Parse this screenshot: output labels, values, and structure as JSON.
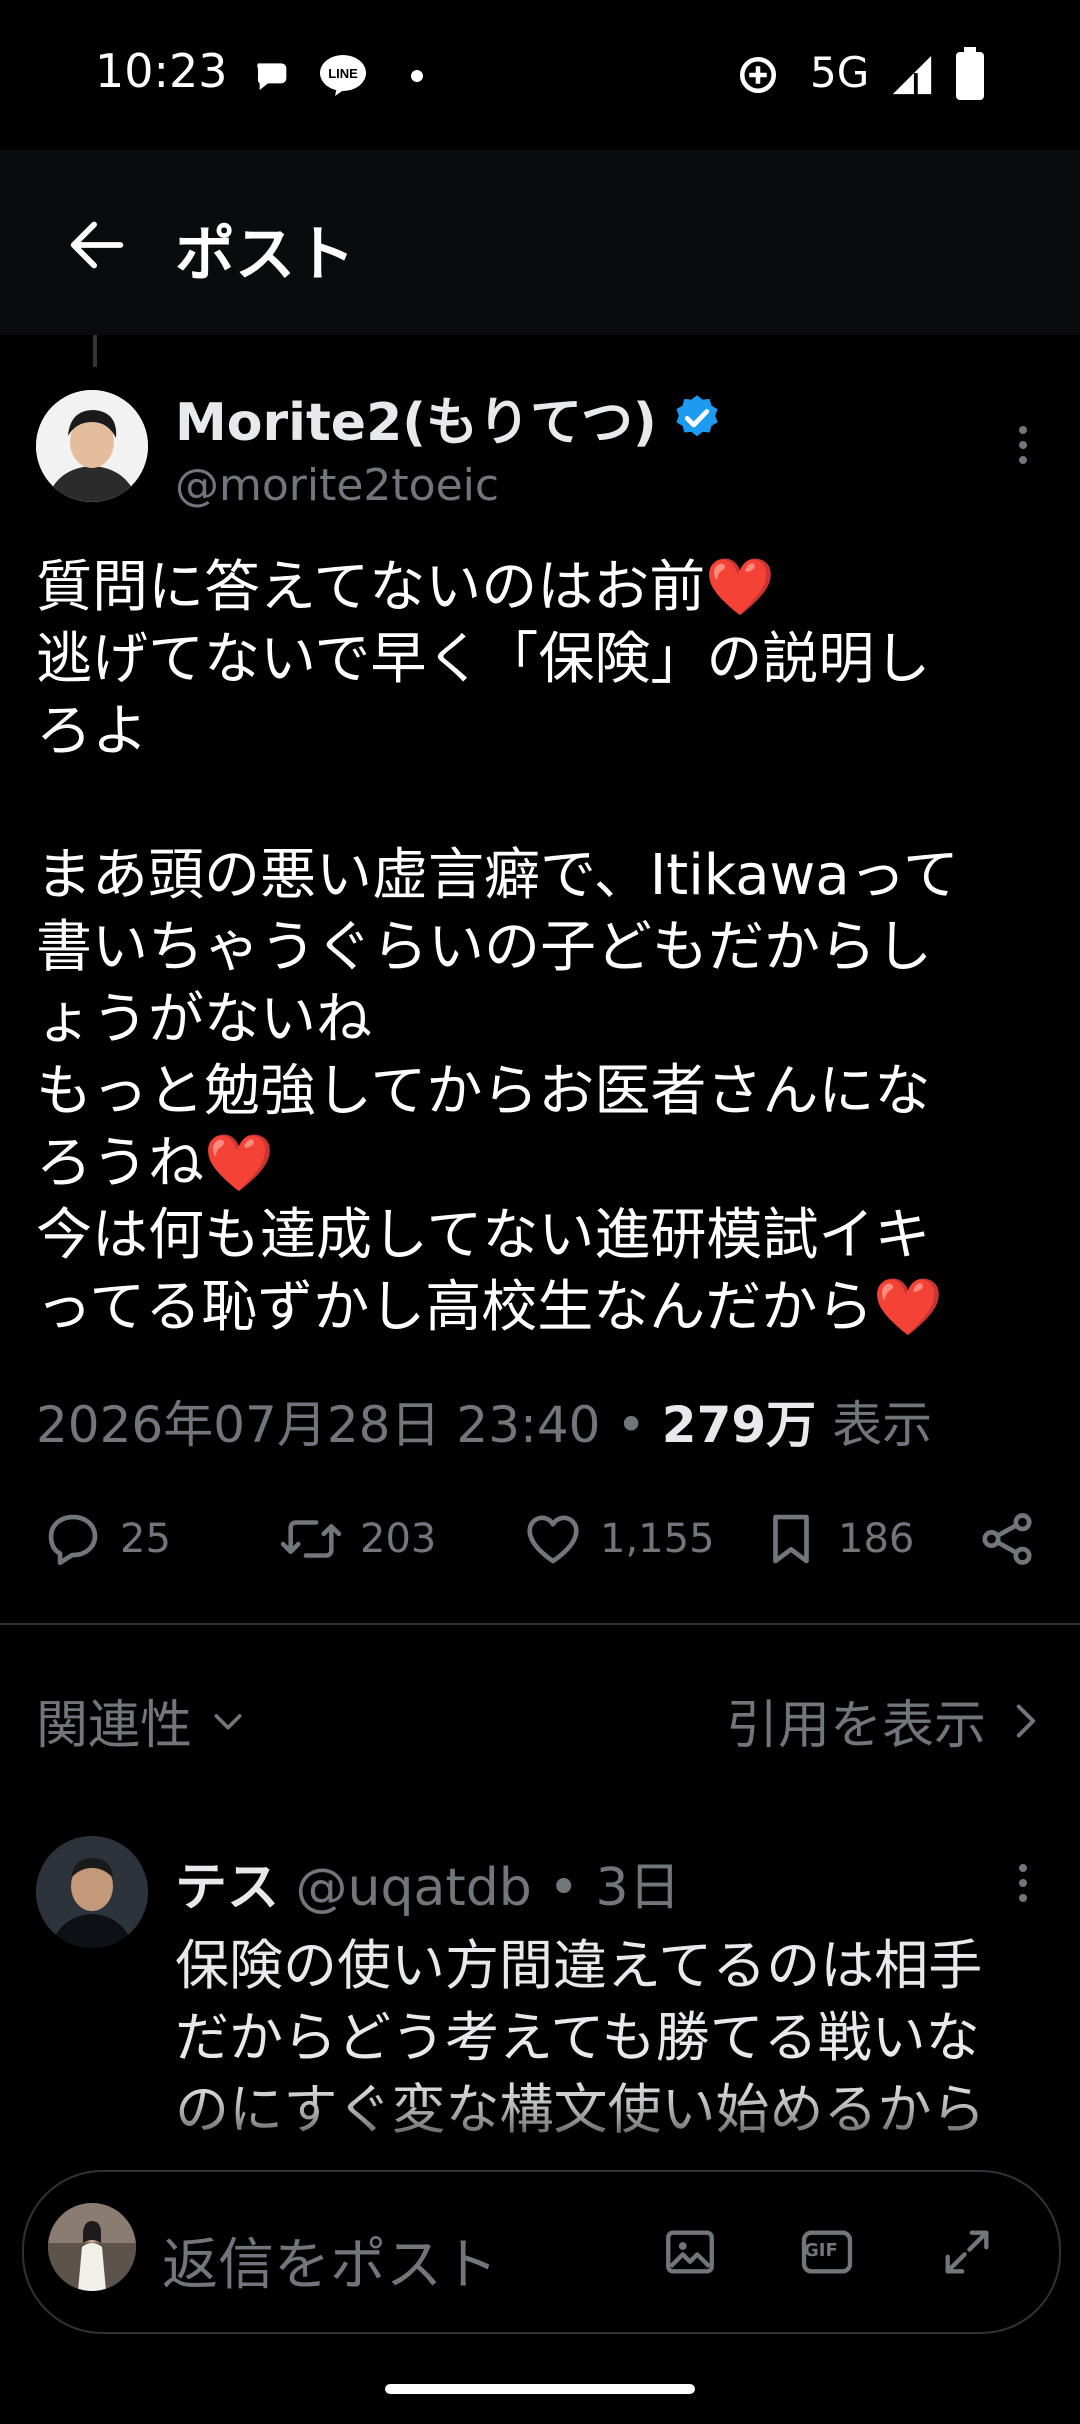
{
  "status_bar": {
    "time": "10:23",
    "network": "5G",
    "app_icons": [
      "chat-bubble-icon",
      "line-app-icon",
      "dot-icon"
    ],
    "system_icons": [
      "data-saver-icon",
      "signal-icon",
      "battery-icon"
    ]
  },
  "header": {
    "title": "ポスト",
    "back_icon": "arrow-left-icon"
  },
  "post": {
    "display_name": "Morite2(もりてつ)",
    "verified": true,
    "handle": "@morite2toeic",
    "line1": "質問に答えてないのはお前",
    "line2": "逃げてないで早く「保険」の説明し",
    "line3": "ろよ",
    "line4": "まあ頭の悪い虚言癖で、Itikawaって",
    "line5": "書いちゃうぐらいの子どもだからし",
    "line6": "ょうがないね",
    "line7": "もっと勉強してからお医者さんにな",
    "line8": "ろうね",
    "line9": "今は何も達成してない進研模試イキ",
    "line10": "ってる恥ずかし高校生なんだから",
    "heart": "❤️",
    "timestamp": "2026年07月28日 23:40",
    "separator": "•",
    "views_count": "279万",
    "views_label": "表示",
    "replies": "25",
    "reposts": "203",
    "likes": "1,155",
    "bookmarks": "186"
  },
  "sort": {
    "label": "関連性",
    "quotes_label": "引用を表示"
  },
  "reply": {
    "name": "テス",
    "handle": "@uqatdb",
    "separator": "•",
    "age": "3日",
    "line1": "保険の使い方間違えてるのは相手",
    "line2": "だからどう考えても勝てる戦いな",
    "line3": "のにすぐ変な構文使い始めるから"
  },
  "compose": {
    "placeholder": "返信をポスト",
    "gif_label": "GIF"
  },
  "colors": {
    "background": "#000000",
    "text": "#e7e9ea",
    "muted": "#71767b",
    "verified": "#1d9bf0",
    "heart": "#f4212e"
  }
}
